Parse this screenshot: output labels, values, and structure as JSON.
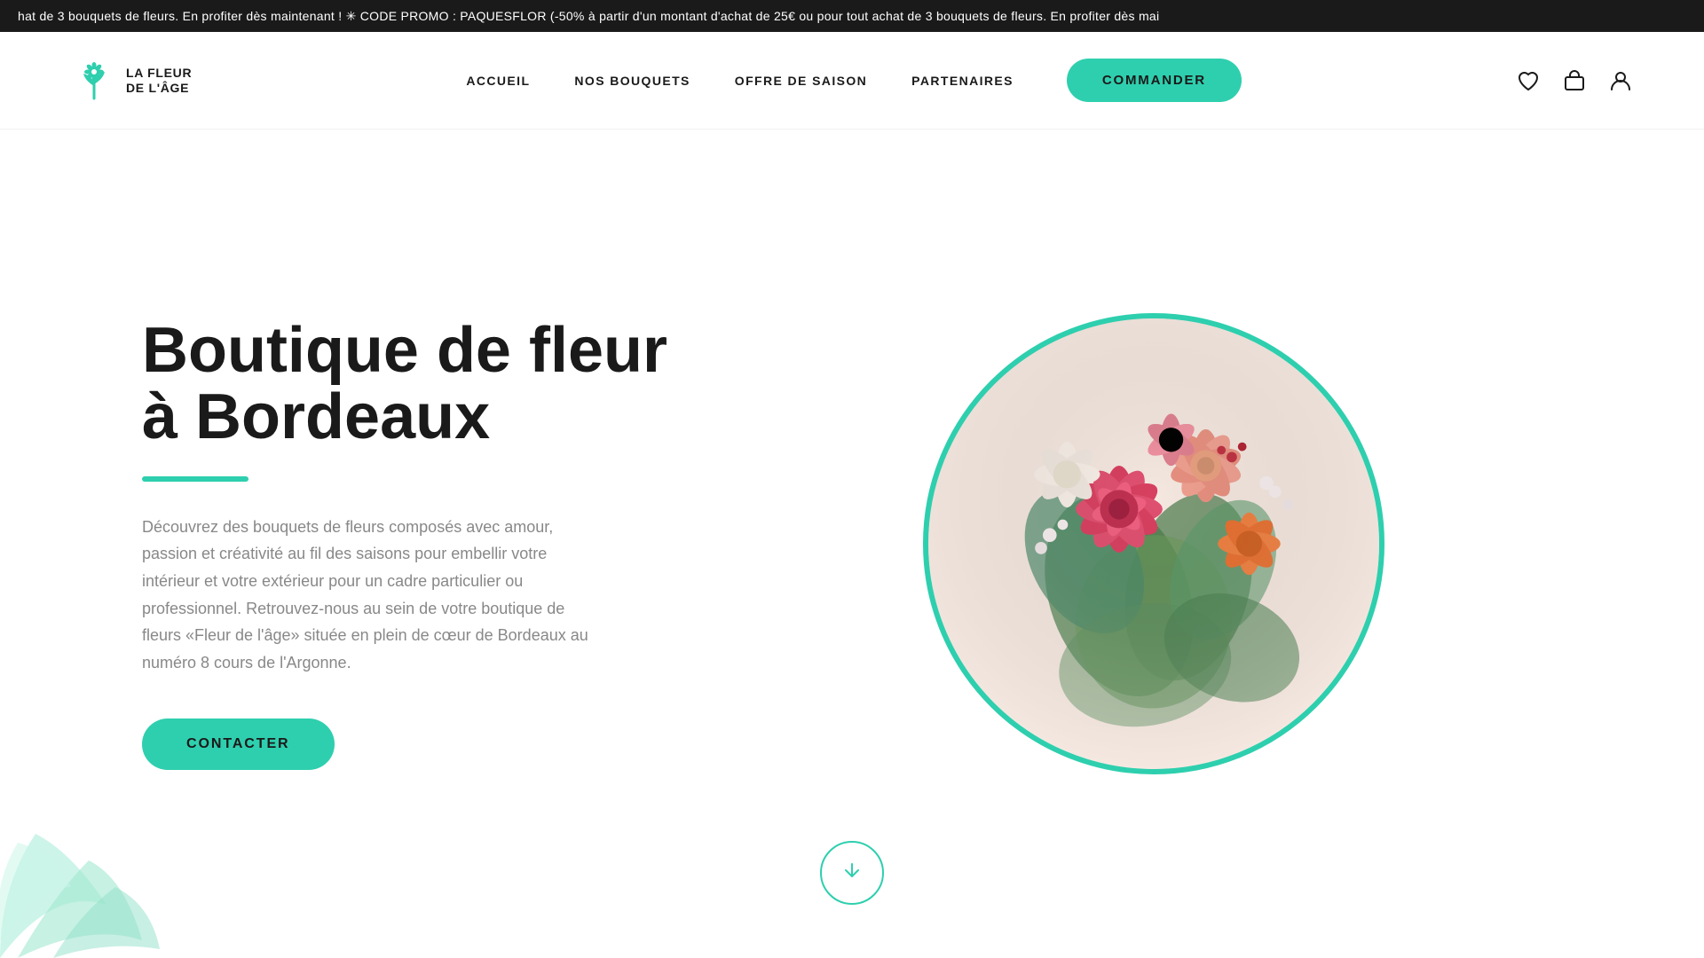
{
  "promo": {
    "text": "hat de 3 bouquets de fleurs. En profiter dès maintenant !  ✳  CODE PROMO : PAQUESFLOR  (-50% à partir d'un montant d'achat de 25€ ou pour tout achat de 3 bouquets de fleurs. En profiter dès mai"
  },
  "header": {
    "logo_line1": "LA FLEUR",
    "logo_line2": "DE L'ÂGE",
    "nav": [
      {
        "label": "ACCUEIL",
        "id": "accueil"
      },
      {
        "label": "NOS BOUQUETS",
        "id": "nos-bouquets"
      },
      {
        "label": "OFFRE DE SAISON",
        "id": "offre-de-saison"
      },
      {
        "label": "PARTENAIRES",
        "id": "partenaires"
      }
    ],
    "commander_label": "COMMANDER"
  },
  "hero": {
    "title_line1": "Boutique de fleur",
    "title_line2": "à Bordeaux",
    "description": "Découvrez des bouquets de fleurs composés avec amour, passion et créativité au fil des saisons pour embellir votre intérieur et votre extérieur pour un cadre particulier ou professionnel. Retrouvez-nous au sein de votre boutique de fleurs «Fleur de l'âge» située en plein de cœur de Bordeaux au numéro 8 cours de l'Argonne.",
    "cta_label": "CONTACTER"
  },
  "colors": {
    "teal": "#2ecfae",
    "dark": "#1a1a1a",
    "gray": "#888888"
  },
  "icons": {
    "heart": "♡",
    "bag": "🛍",
    "user": "👤",
    "arrow_down": "↓"
  }
}
